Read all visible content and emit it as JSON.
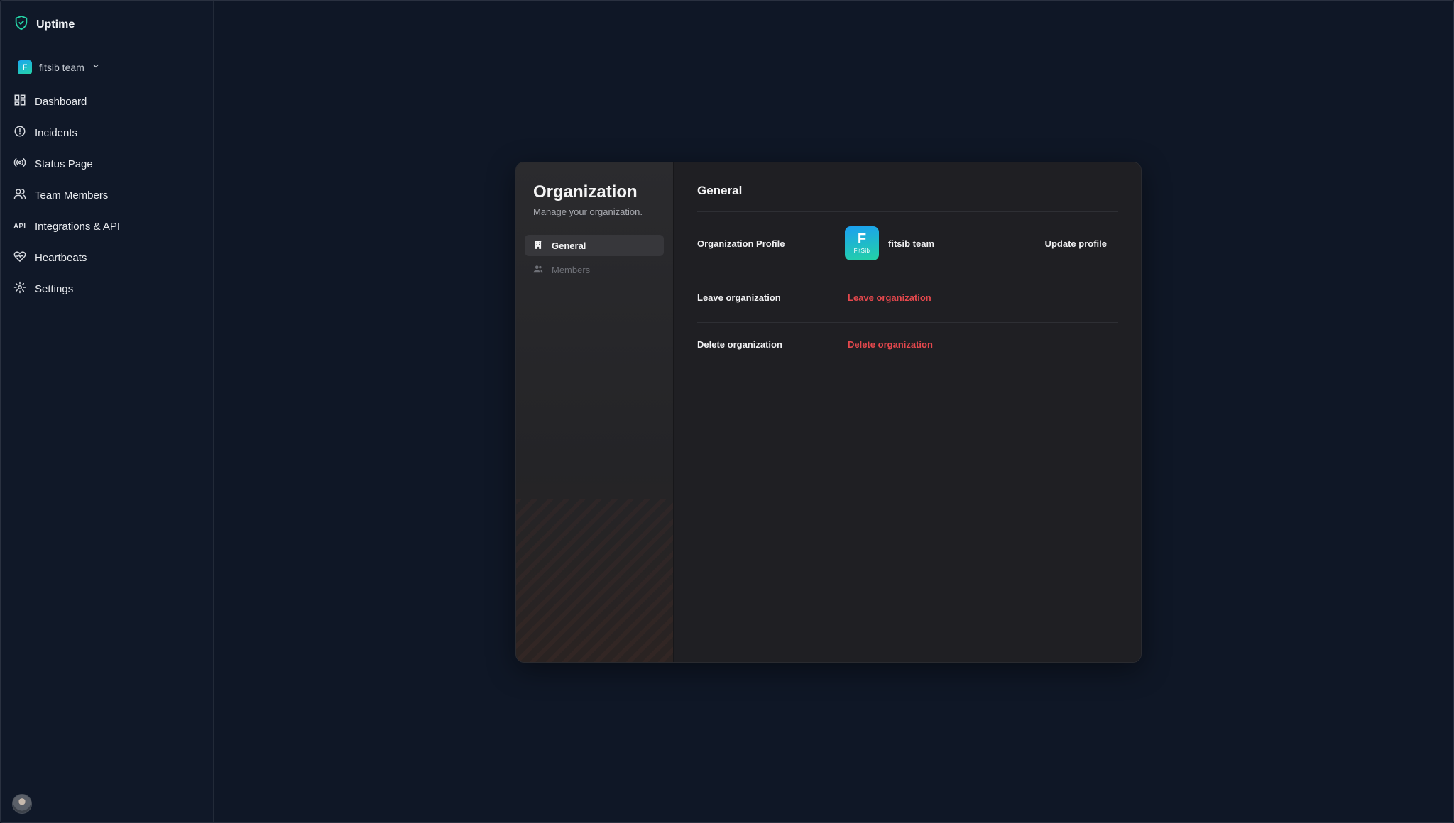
{
  "app": {
    "name": "Uptime"
  },
  "team_switcher": {
    "team_name": "fitsib team",
    "avatar_letter": "F"
  },
  "nav": {
    "items": [
      {
        "label": "Dashboard",
        "icon": "dashboard-icon"
      },
      {
        "label": "Incidents",
        "icon": "alert-circle-icon"
      },
      {
        "label": "Status Page",
        "icon": "broadcast-icon"
      },
      {
        "label": "Team Members",
        "icon": "users-icon"
      },
      {
        "label": "Integrations & API",
        "icon": "api-icon",
        "glyph": "API"
      },
      {
        "label": "Heartbeats",
        "icon": "heartbeat-icon"
      },
      {
        "label": "Settings",
        "icon": "gear-icon"
      }
    ]
  },
  "modal": {
    "title": "Organization",
    "subtitle": "Manage your organization.",
    "tabs": [
      {
        "label": "General",
        "icon": "building-icon",
        "active": true
      },
      {
        "label": "Members",
        "icon": "users-icon",
        "active": false
      }
    ],
    "section_title": "General",
    "profile": {
      "label": "Organization Profile",
      "org_name": "fitsib team",
      "logo_mark": "F",
      "logo_word": "FitSib",
      "update_label": "Update profile"
    },
    "leave": {
      "label": "Leave organization",
      "action": "Leave organization"
    },
    "delete": {
      "label": "Delete organization",
      "action": "Delete organization"
    }
  },
  "colors": {
    "background": "#0f1726",
    "accent": "#25d3a6",
    "danger": "#e5484d"
  }
}
